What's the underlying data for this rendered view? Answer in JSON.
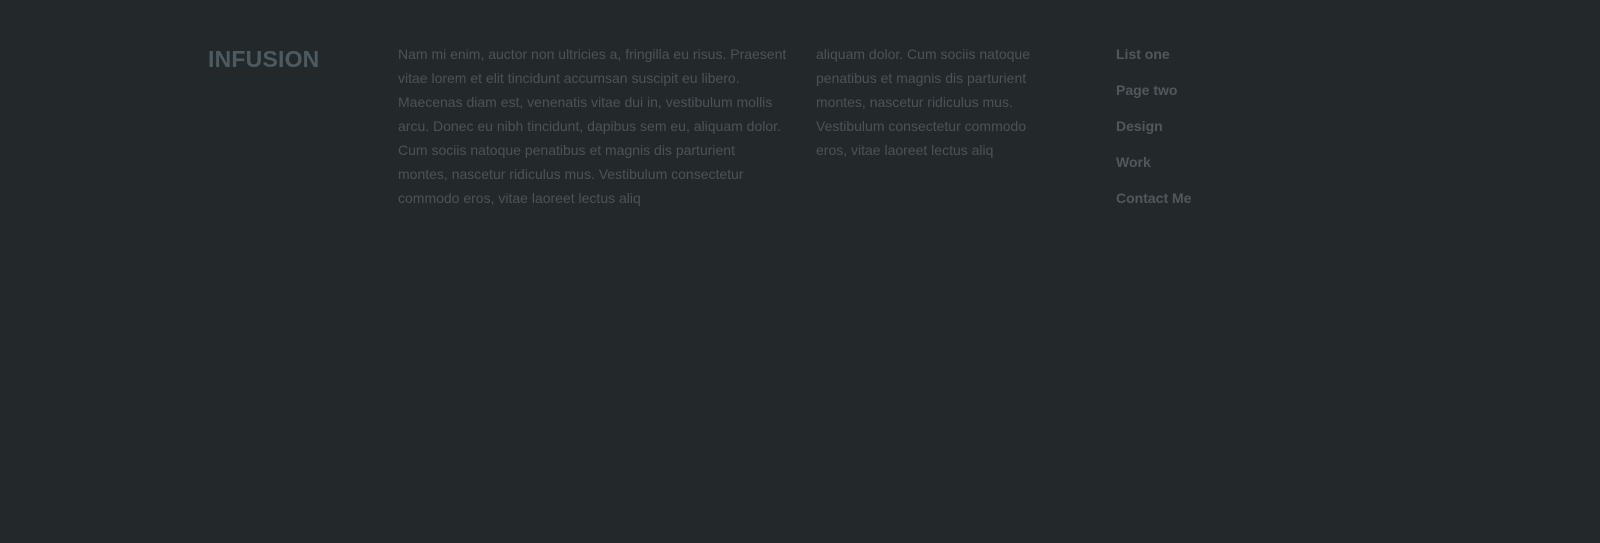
{
  "footer": {
    "brand": "INFUSION",
    "text_column_one": "Nam mi enim, auctor non ultricies a, fringilla eu risus. Praesent vitae lorem et elit tincidunt accumsan suscipit eu libero. Maecenas diam est, venenatis vitae dui in, vestibulum mollis arcu. Donec eu nibh tincidunt, dapibus sem eu, aliquam dolor. Cum sociis natoque penatibus et magnis dis parturient montes, nascetur ridiculus mus. Vestibulum consectetur commodo eros, vitae laoreet lectus aliq",
    "text_column_two": "aliquam dolor. Cum sociis natoque penatibus et magnis dis parturient montes, nascetur ridiculus mus. Vestibulum consectetur commodo eros, vitae laoreet lectus aliq",
    "links": [
      {
        "label": "List one"
      },
      {
        "label": "Page two"
      },
      {
        "label": "Design"
      },
      {
        "label": "Work"
      },
      {
        "label": "Contact Me"
      }
    ]
  },
  "colors": {
    "background": "#23282b",
    "brand": "#4d5a60",
    "text": "#4b5357",
    "link": "#51585c"
  }
}
